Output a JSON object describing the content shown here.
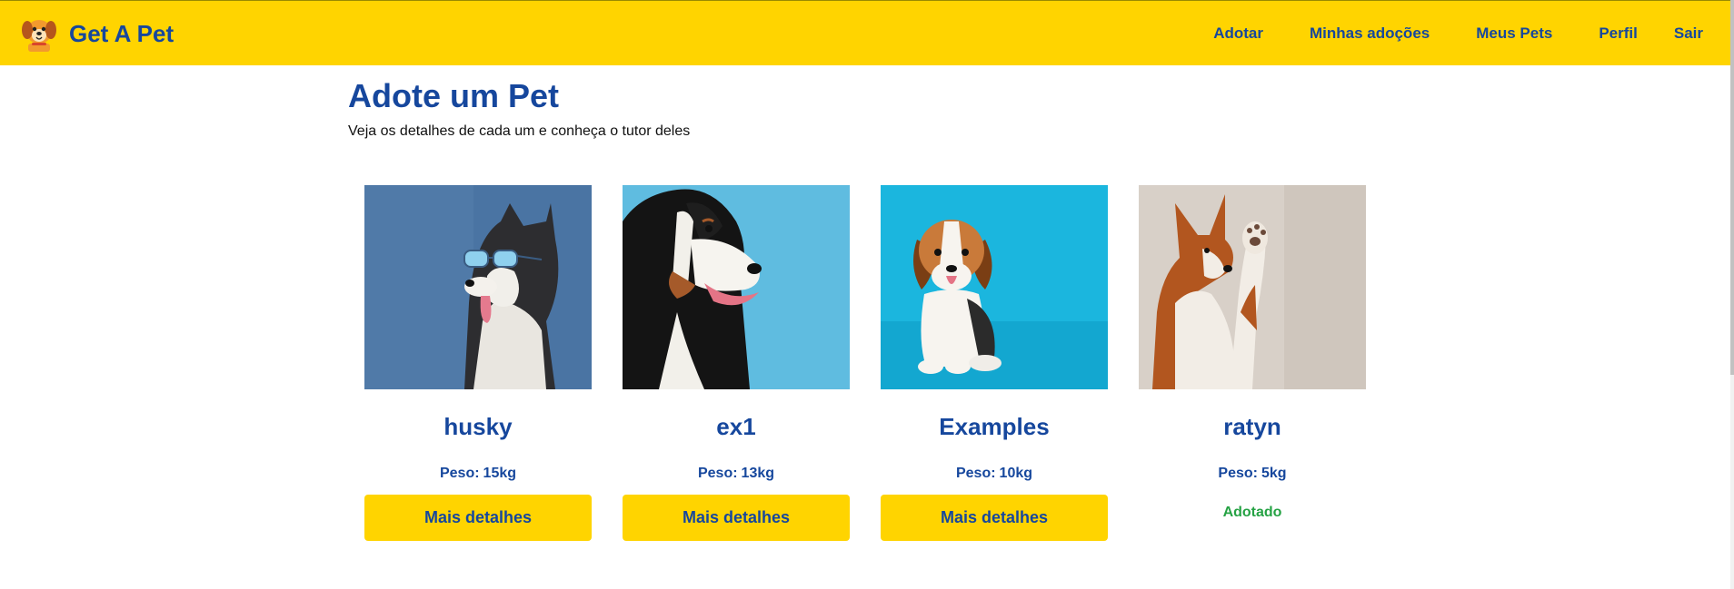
{
  "brand": {
    "name": "Get A Pet",
    "logo_icon": "dog-logo-icon"
  },
  "nav": {
    "items": [
      {
        "label": "Adotar"
      },
      {
        "label": "Minhas adoções"
      },
      {
        "label": "Meus Pets"
      },
      {
        "label": "Perfil"
      },
      {
        "label": "Sair"
      }
    ]
  },
  "header": {
    "title": "Adote um Pet",
    "subtitle": "Veja os detalhes de cada um e conheça o tutor deles"
  },
  "pets": [
    {
      "name": "husky",
      "weight_label": "Peso:",
      "weight": "15kg",
      "action": "Mais detalhes",
      "image": "husky-with-sunglasses-photo"
    },
    {
      "name": "ex1",
      "weight_label": "Peso:",
      "weight": "13kg",
      "action": "Mais detalhes",
      "image": "bernese-dog-photo"
    },
    {
      "name": "Examples",
      "weight_label": "Peso:",
      "weight": "10kg",
      "action": "Mais detalhes",
      "image": "beagle-puppy-photo"
    },
    {
      "name": "ratyn",
      "weight_label": "Peso:",
      "weight": "5kg",
      "status": "Adotado",
      "image": "basenji-waving-photo"
    }
  ],
  "colors": {
    "brand_yellow": "#FFD400",
    "brand_blue": "#16479d",
    "adopted_green": "#25a244"
  }
}
